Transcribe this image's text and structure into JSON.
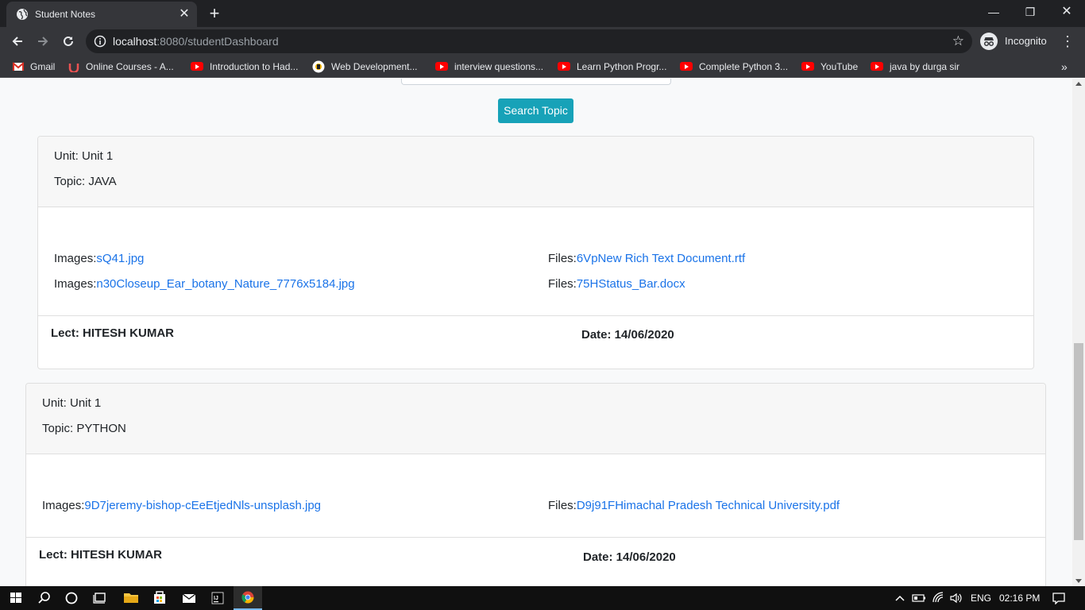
{
  "browser": {
    "tab_title": "Student Notes",
    "url_host": "localhost",
    "url_path": ":8080/studentDashboard",
    "profile_label": "Incognito",
    "bookmarks": [
      {
        "label": "Gmail",
        "icon": "gmail-icon"
      },
      {
        "label": "Online Courses - A...",
        "icon": "udemy-icon"
      },
      {
        "label": "Introduction to Had...",
        "icon": "youtube-icon"
      },
      {
        "label": "Web Development...",
        "icon": "web-icon"
      },
      {
        "label": "interview questions...",
        "icon": "youtube-icon"
      },
      {
        "label": "Learn Python Progr...",
        "icon": "youtube-icon"
      },
      {
        "label": "Complete Python 3...",
        "icon": "youtube-icon"
      },
      {
        "label": "YouTube",
        "icon": "youtube-icon"
      },
      {
        "label": "java by durga sir",
        "icon": "youtube-icon"
      }
    ]
  },
  "page": {
    "search_button_label": "Search Topic",
    "notes": [
      {
        "unit": "Unit: Unit 1",
        "topic": "Topic: JAVA",
        "images": [
          {
            "prefix": "Images:",
            "file": "sQ41.jpg"
          },
          {
            "prefix": "Images:",
            "file": "n30Closeup_Ear_botany_Nature_7776x5184.jpg"
          }
        ],
        "files": [
          {
            "prefix": "Files:",
            "file": "6VpNew Rich Text Document.rtf"
          },
          {
            "prefix": "Files:",
            "file": "75HStatus_Bar.docx"
          }
        ],
        "lecturer": "Lect: HITESH KUMAR",
        "date": "Date: 14/06/2020"
      },
      {
        "unit": "Unit: Unit 1",
        "topic": "Topic: PYTHON",
        "images": [
          {
            "prefix": "Images:",
            "file": "9D7jeremy-bishop-cEeEtjedNls-unsplash.jpg"
          }
        ],
        "files": [
          {
            "prefix": "Files:",
            "file": "D9j91FHimachal Pradesh Technical University.pdf"
          }
        ],
        "lecturer": "Lect: HITESH KUMAR",
        "date": "Date: 14/06/2020"
      }
    ]
  },
  "taskbar": {
    "language": "ENG",
    "time": "02:16 PM"
  },
  "colors": {
    "accent_button": "#17a2b8",
    "link": "#1a73e8",
    "chrome_dark": "#202124",
    "chrome_toolbar": "#35363a"
  }
}
